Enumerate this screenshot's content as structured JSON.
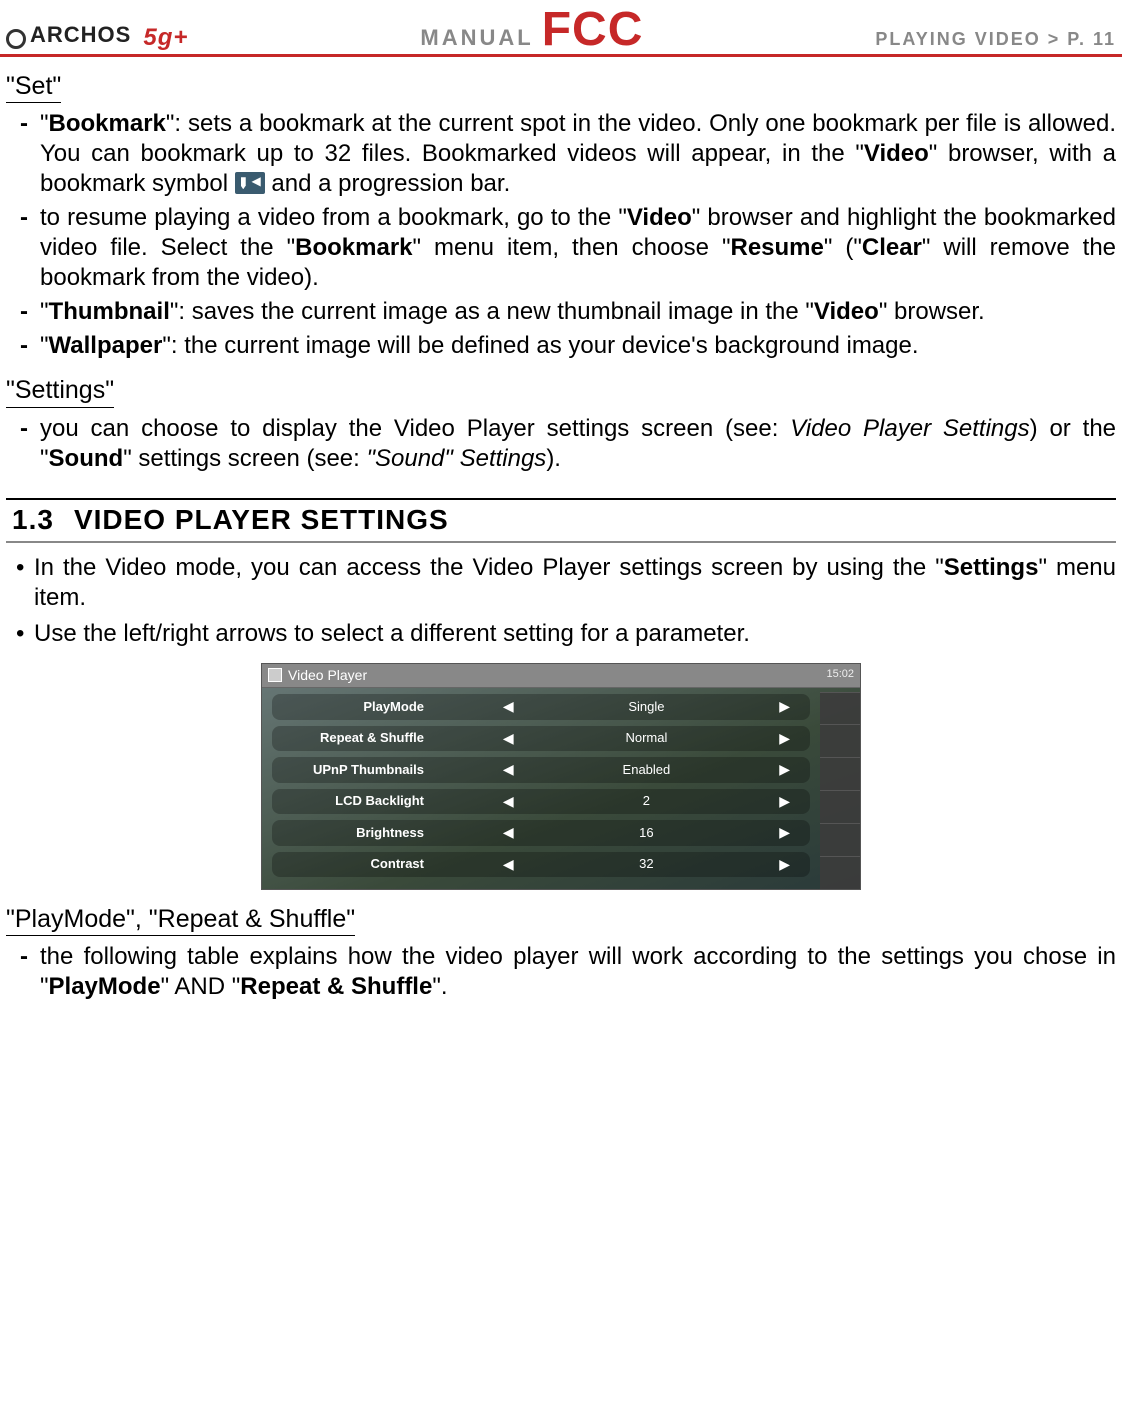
{
  "header": {
    "logo_text": "ARCHOS",
    "model": "5g+",
    "manual": "MANUAL",
    "fcc": "FCC",
    "breadcrumb": "PLAYING VIDEO   >   P. 11"
  },
  "set": {
    "label": "\"Set\"",
    "items": [
      {
        "html": "\"<b>Bookmark</b>\": sets a bookmark at the current spot in the video. Only one bookmark per file is allowed. You can bookmark up to 32 files. Bookmarked videos will appear, in the \"<b>Video</b>\" browser, with a bookmark symbol <span class='bookmark-icon' data-name='bookmark-icon' data-interactable='false'></span> and a progression bar."
      },
      {
        "html": "to resume playing a video from a bookmark, go to the \"<b>Video</b>\" browser and highlight the bookmarked video file. Select the \"<b>Bookmark</b>\" menu item, then choose \"<b>Resume</b>\" (\"<b>Clear</b>\" will remove the bookmark from the video)."
      },
      {
        "html": "\"<b>Thumbnail</b>\": saves the current image as a new thumbnail image in the \"<b>Video</b>\" browser."
      },
      {
        "html": "\"<b>Wallpaper</b>\": the current image will be defined as your device's background image."
      }
    ]
  },
  "settings": {
    "label": "\"Settings\"",
    "items": [
      {
        "html": "you can choose to display the Video Player settings screen (see: <i>Video Player Settings</i>) or the \"<b>Sound</b>\" settings screen (see: <i>\"Sound\" Settings</i>)."
      }
    ]
  },
  "section13": {
    "num": "1.3",
    "title": "VIDEO PLAYER SETTINGS",
    "bullets": [
      {
        "html": "In the Video mode, you can access the Video Player settings screen by using the \"<b>Settings</b>\" menu item."
      },
      {
        "html": "Use the left/right arrows to select a different setting for a parameter."
      }
    ]
  },
  "screenshot": {
    "title": "Video Player",
    "time": "15:02",
    "rows": [
      {
        "label": "PlayMode",
        "value": "Single"
      },
      {
        "label": "Repeat & Shuffle",
        "value": "Normal"
      },
      {
        "label": "UPnP Thumbnails",
        "value": "Enabled"
      },
      {
        "label": "LCD Backlight",
        "value": "2"
      },
      {
        "label": "Brightness",
        "value": "16"
      },
      {
        "label": "Contrast",
        "value": "32"
      }
    ]
  },
  "playmode": {
    "label": "\"PlayMode\", \"Repeat & Shuffle\"",
    "items": [
      {
        "html": "the following table explains how the video player will work according to the settings you chose in \"<b>PlayMode</b>\" AND \"<b>Repeat & Shuffle</b>\"."
      }
    ]
  }
}
